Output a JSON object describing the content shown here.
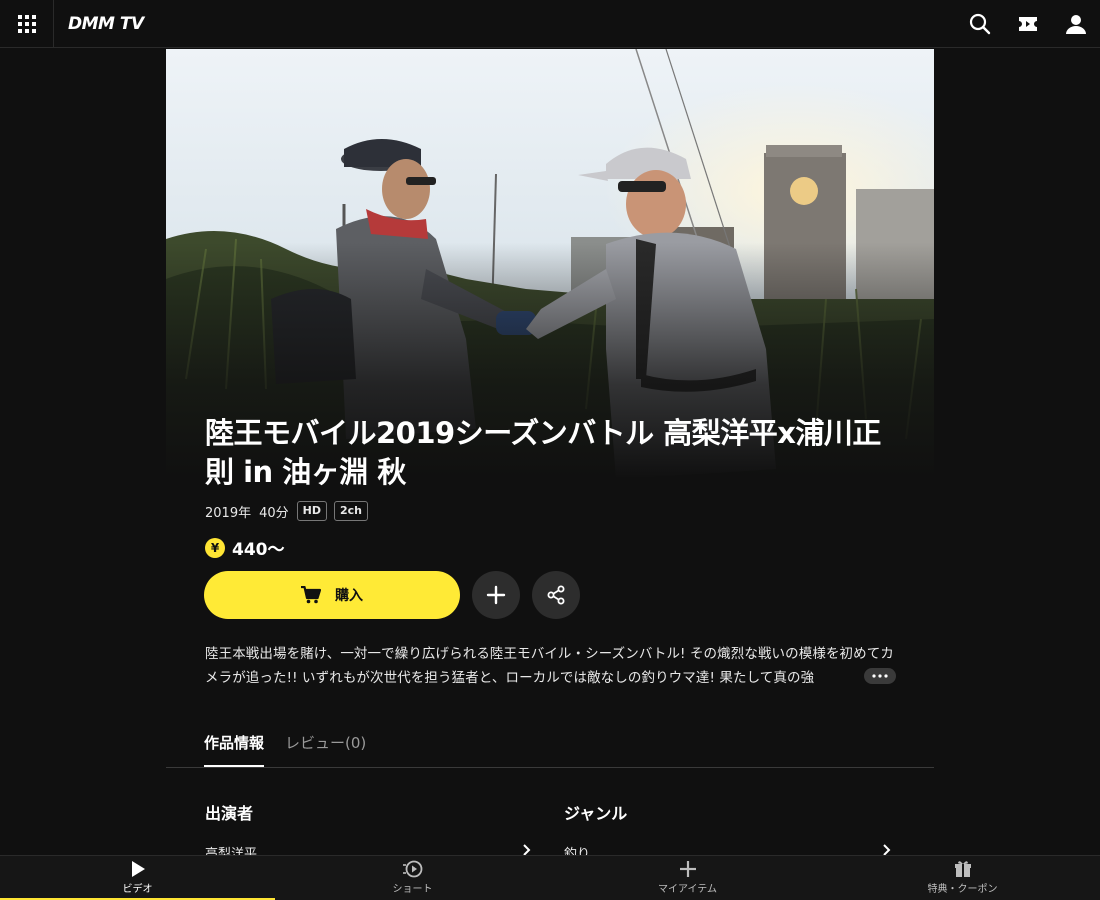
{
  "header": {
    "logo_text": "DMM TV",
    "icons": [
      "apps-grid-icon",
      "search-icon",
      "ticket-icon",
      "account-icon"
    ]
  },
  "video": {
    "title": "陸王モバイル2019シーズンバトル 高梨洋平x浦川正則 in 油ヶ淵 秋",
    "year": "2019年",
    "duration": "40分",
    "badges": [
      "HD",
      "2ch"
    ],
    "price_symbol": "¥",
    "price": "440〜",
    "buy_label": "購入",
    "description": "陸王本戦出場を賭け、一対一で繰り広げられる陸王モバイル・シーズンバトル! その熾烈な戦いの模様を初めてカメラが追った!! いずれもが次世代を担う猛者と、ローカルでは敵なしの釣りウマ達! 果たして真の強"
  },
  "tabs": [
    {
      "label": "作品情報",
      "active": true
    },
    {
      "label": "レビュー(0)",
      "active": false
    }
  ],
  "info": {
    "cast_heading": "出演者",
    "cast_first": "高梨洋平",
    "genre_heading": "ジャンル",
    "genre_first": "釣り"
  },
  "bottom_nav": [
    {
      "label": "ビデオ",
      "active": true
    },
    {
      "label": "ショート",
      "active": false
    },
    {
      "label": "マイアイテム",
      "active": false
    },
    {
      "label": "特典・クーポン",
      "active": false
    }
  ],
  "colors": {
    "accent_yellow": "#ffea36",
    "background": "#101010"
  }
}
